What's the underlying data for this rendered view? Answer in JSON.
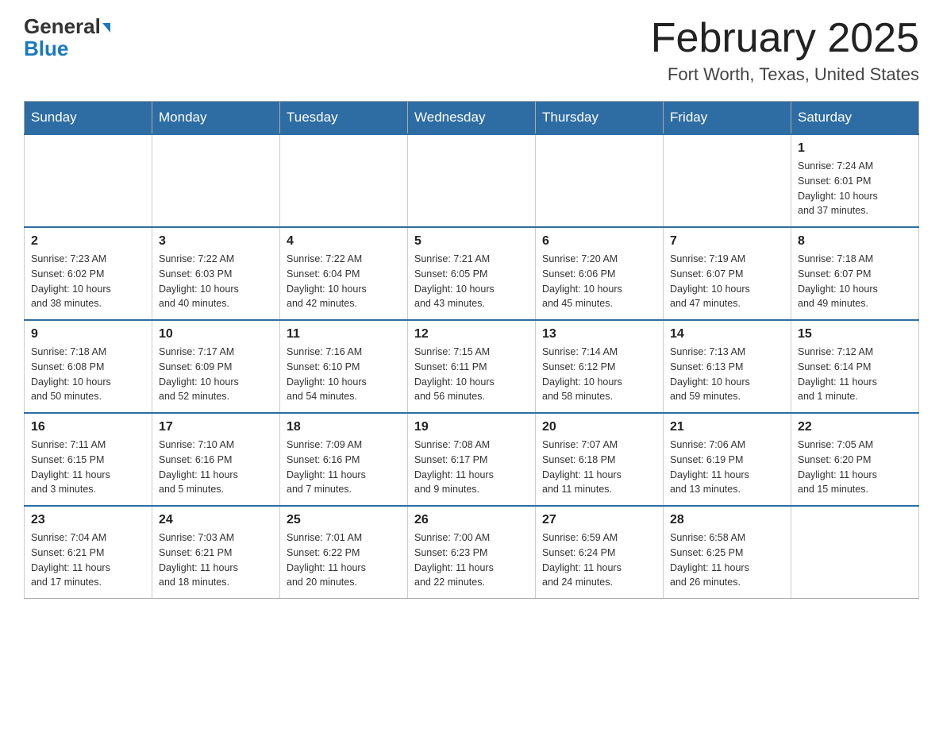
{
  "header": {
    "logo_line1": "General",
    "logo_line2": "Blue",
    "title": "February 2025",
    "subtitle": "Fort Worth, Texas, United States"
  },
  "days_of_week": [
    "Sunday",
    "Monday",
    "Tuesday",
    "Wednesday",
    "Thursday",
    "Friday",
    "Saturday"
  ],
  "weeks": [
    [
      {
        "day": "",
        "info": ""
      },
      {
        "day": "",
        "info": ""
      },
      {
        "day": "",
        "info": ""
      },
      {
        "day": "",
        "info": ""
      },
      {
        "day": "",
        "info": ""
      },
      {
        "day": "",
        "info": ""
      },
      {
        "day": "1",
        "info": "Sunrise: 7:24 AM\nSunset: 6:01 PM\nDaylight: 10 hours\nand 37 minutes."
      }
    ],
    [
      {
        "day": "2",
        "info": "Sunrise: 7:23 AM\nSunset: 6:02 PM\nDaylight: 10 hours\nand 38 minutes."
      },
      {
        "day": "3",
        "info": "Sunrise: 7:22 AM\nSunset: 6:03 PM\nDaylight: 10 hours\nand 40 minutes."
      },
      {
        "day": "4",
        "info": "Sunrise: 7:22 AM\nSunset: 6:04 PM\nDaylight: 10 hours\nand 42 minutes."
      },
      {
        "day": "5",
        "info": "Sunrise: 7:21 AM\nSunset: 6:05 PM\nDaylight: 10 hours\nand 43 minutes."
      },
      {
        "day": "6",
        "info": "Sunrise: 7:20 AM\nSunset: 6:06 PM\nDaylight: 10 hours\nand 45 minutes."
      },
      {
        "day": "7",
        "info": "Sunrise: 7:19 AM\nSunset: 6:07 PM\nDaylight: 10 hours\nand 47 minutes."
      },
      {
        "day": "8",
        "info": "Sunrise: 7:18 AM\nSunset: 6:07 PM\nDaylight: 10 hours\nand 49 minutes."
      }
    ],
    [
      {
        "day": "9",
        "info": "Sunrise: 7:18 AM\nSunset: 6:08 PM\nDaylight: 10 hours\nand 50 minutes."
      },
      {
        "day": "10",
        "info": "Sunrise: 7:17 AM\nSunset: 6:09 PM\nDaylight: 10 hours\nand 52 minutes."
      },
      {
        "day": "11",
        "info": "Sunrise: 7:16 AM\nSunset: 6:10 PM\nDaylight: 10 hours\nand 54 minutes."
      },
      {
        "day": "12",
        "info": "Sunrise: 7:15 AM\nSunset: 6:11 PM\nDaylight: 10 hours\nand 56 minutes."
      },
      {
        "day": "13",
        "info": "Sunrise: 7:14 AM\nSunset: 6:12 PM\nDaylight: 10 hours\nand 58 minutes."
      },
      {
        "day": "14",
        "info": "Sunrise: 7:13 AM\nSunset: 6:13 PM\nDaylight: 10 hours\nand 59 minutes."
      },
      {
        "day": "15",
        "info": "Sunrise: 7:12 AM\nSunset: 6:14 PM\nDaylight: 11 hours\nand 1 minute."
      }
    ],
    [
      {
        "day": "16",
        "info": "Sunrise: 7:11 AM\nSunset: 6:15 PM\nDaylight: 11 hours\nand 3 minutes."
      },
      {
        "day": "17",
        "info": "Sunrise: 7:10 AM\nSunset: 6:16 PM\nDaylight: 11 hours\nand 5 minutes."
      },
      {
        "day": "18",
        "info": "Sunrise: 7:09 AM\nSunset: 6:16 PM\nDaylight: 11 hours\nand 7 minutes."
      },
      {
        "day": "19",
        "info": "Sunrise: 7:08 AM\nSunset: 6:17 PM\nDaylight: 11 hours\nand 9 minutes."
      },
      {
        "day": "20",
        "info": "Sunrise: 7:07 AM\nSunset: 6:18 PM\nDaylight: 11 hours\nand 11 minutes."
      },
      {
        "day": "21",
        "info": "Sunrise: 7:06 AM\nSunset: 6:19 PM\nDaylight: 11 hours\nand 13 minutes."
      },
      {
        "day": "22",
        "info": "Sunrise: 7:05 AM\nSunset: 6:20 PM\nDaylight: 11 hours\nand 15 minutes."
      }
    ],
    [
      {
        "day": "23",
        "info": "Sunrise: 7:04 AM\nSunset: 6:21 PM\nDaylight: 11 hours\nand 17 minutes."
      },
      {
        "day": "24",
        "info": "Sunrise: 7:03 AM\nSunset: 6:21 PM\nDaylight: 11 hours\nand 18 minutes."
      },
      {
        "day": "25",
        "info": "Sunrise: 7:01 AM\nSunset: 6:22 PM\nDaylight: 11 hours\nand 20 minutes."
      },
      {
        "day": "26",
        "info": "Sunrise: 7:00 AM\nSunset: 6:23 PM\nDaylight: 11 hours\nand 22 minutes."
      },
      {
        "day": "27",
        "info": "Sunrise: 6:59 AM\nSunset: 6:24 PM\nDaylight: 11 hours\nand 24 minutes."
      },
      {
        "day": "28",
        "info": "Sunrise: 6:58 AM\nSunset: 6:25 PM\nDaylight: 11 hours\nand 26 minutes."
      },
      {
        "day": "",
        "info": ""
      }
    ]
  ]
}
